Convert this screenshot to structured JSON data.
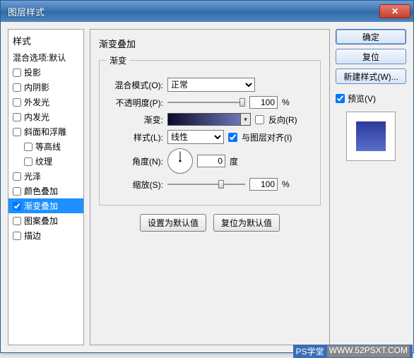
{
  "window": {
    "title": "图层样式"
  },
  "styles": {
    "header": "样式",
    "blending": "混合选项:默认",
    "items": [
      {
        "label": "投影",
        "checked": false
      },
      {
        "label": "内阴影",
        "checked": false
      },
      {
        "label": "外发光",
        "checked": false
      },
      {
        "label": "内发光",
        "checked": false
      },
      {
        "label": "斜面和浮雕",
        "checked": false
      },
      {
        "label": "等高线",
        "checked": false,
        "indent": true
      },
      {
        "label": "纹理",
        "checked": false,
        "indent": true
      },
      {
        "label": "光泽",
        "checked": false
      },
      {
        "label": "颜色叠加",
        "checked": false
      },
      {
        "label": "渐变叠加",
        "checked": true,
        "selected": true
      },
      {
        "label": "图案叠加",
        "checked": false
      },
      {
        "label": "描边",
        "checked": false
      }
    ]
  },
  "panel": {
    "title": "渐变叠加",
    "fieldset": "渐变",
    "blend_mode_label": "混合模式(O):",
    "blend_mode_value": "正常",
    "opacity_label": "不透明度(P):",
    "opacity_value": "100",
    "percent": "%",
    "gradient_label": "渐变:",
    "reverse_label": "反向(R)",
    "style_label": "样式(L):",
    "style_value": "线性",
    "align_label": "与图层对齐(I)",
    "angle_label": "角度(N):",
    "angle_value": "0",
    "degree": "度",
    "scale_label": "缩放(S):",
    "scale_value": "100",
    "btn_default": "设置为默认值",
    "btn_reset": "复位为默认值"
  },
  "right": {
    "ok": "确定",
    "cancel": "复位",
    "new_style": "新建样式(W)...",
    "preview_label": "预览(V)"
  },
  "watermark": {
    "t1": "PS学堂",
    "t2": "WWW.52PSXT.COM"
  }
}
